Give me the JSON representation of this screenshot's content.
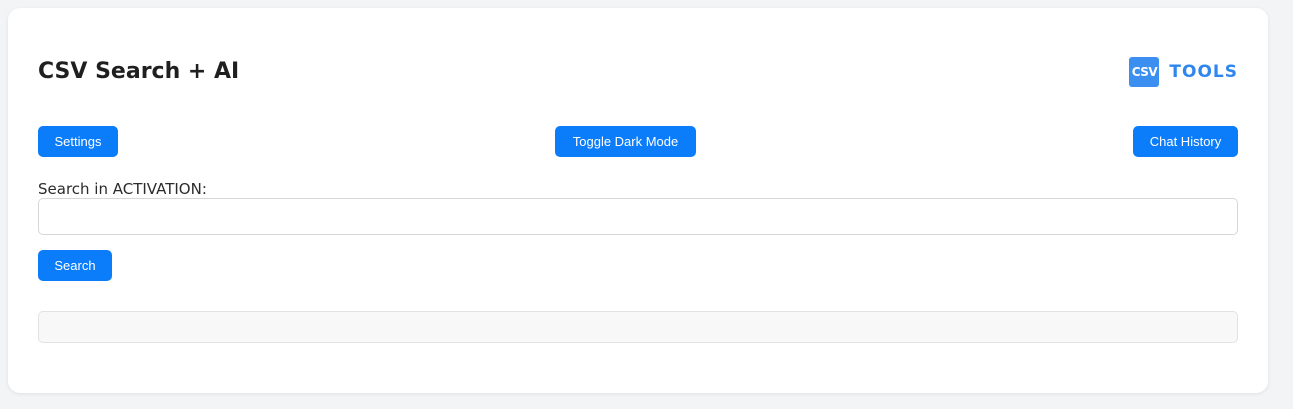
{
  "app": {
    "title": "CSV Search + AI"
  },
  "logo": {
    "badge_text": "CSV",
    "text": "TOOLS"
  },
  "toolbar": {
    "settings_label": "Settings",
    "toggle_dark_label": "Toggle Dark Mode",
    "chat_history_label": "Chat History"
  },
  "search": {
    "label": "Search in ACTIVATION:",
    "value": "",
    "placeholder": "",
    "button_label": "Search"
  },
  "results": {
    "text": ""
  },
  "colors": {
    "accent": "#0b7dfb",
    "logo_text": "#2f86ee",
    "background": "#f3f4f6",
    "card": "#ffffff"
  }
}
